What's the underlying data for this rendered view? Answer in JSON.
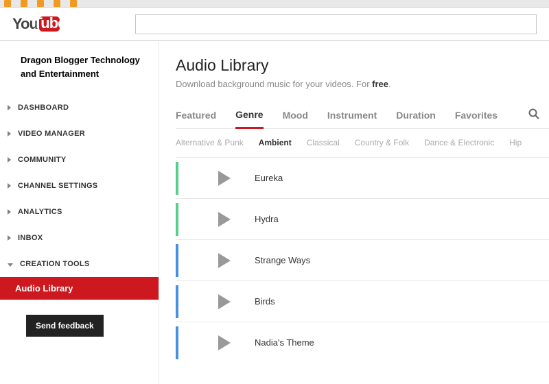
{
  "logo": {
    "part1": "You",
    "part2": "Tube"
  },
  "channel_name": "Dragon Blogger Technology and Entertainment",
  "sidebar": {
    "items": [
      {
        "label": "DASHBOARD"
      },
      {
        "label": "VIDEO MANAGER"
      },
      {
        "label": "COMMUNITY"
      },
      {
        "label": "CHANNEL SETTINGS"
      },
      {
        "label": "ANALYTICS"
      },
      {
        "label": "INBOX"
      },
      {
        "label": "CREATION TOOLS"
      }
    ],
    "active_sub": "Audio Library",
    "feedback": "Send feedback"
  },
  "main": {
    "title": "Audio Library",
    "subtitle_prefix": "Download background music for your videos. For ",
    "subtitle_bold": "free",
    "subtitle_suffix": ".",
    "tabs": [
      {
        "label": "Featured"
      },
      {
        "label": "Genre"
      },
      {
        "label": "Mood"
      },
      {
        "label": "Instrument"
      },
      {
        "label": "Duration"
      },
      {
        "label": "Favorites"
      }
    ],
    "genres": [
      {
        "label": "Alternative & Punk"
      },
      {
        "label": "Ambient"
      },
      {
        "label": "Classical"
      },
      {
        "label": "Country & Folk"
      },
      {
        "label": "Dance & Electronic"
      },
      {
        "label": "Hip"
      }
    ],
    "tracks": [
      {
        "name": "Eureka",
        "color": "green"
      },
      {
        "name": "Hydra",
        "color": "green"
      },
      {
        "name": "Strange Ways",
        "color": "blue"
      },
      {
        "name": "Birds",
        "color": "blue"
      },
      {
        "name": "Nadia's Theme",
        "color": "blue"
      }
    ]
  }
}
